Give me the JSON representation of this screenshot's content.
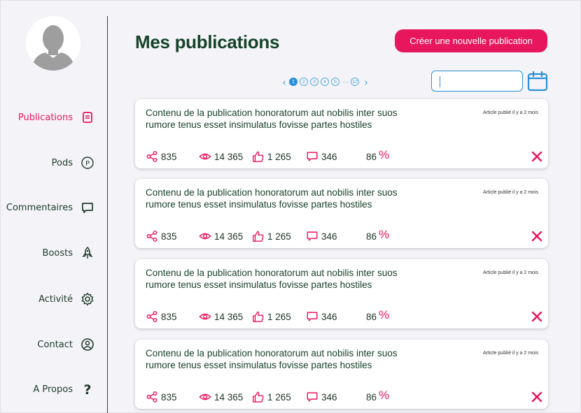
{
  "sidebar": {
    "items": [
      {
        "label": "Publications",
        "icon": "document-icon",
        "active": true
      },
      {
        "label": "Pods",
        "icon": "p-circle-icon",
        "active": false
      },
      {
        "label": "Commentaires",
        "icon": "comment-icon",
        "active": false
      },
      {
        "label": "Boosts",
        "icon": "rocket-icon",
        "active": false
      },
      {
        "label": "Activité",
        "icon": "gear-icon",
        "active": false
      },
      {
        "label": "Contact",
        "icon": "user-circle-icon",
        "active": false
      },
      {
        "label": "A Propos",
        "icon": "question-icon",
        "active": false
      }
    ]
  },
  "header": {
    "title": "Mes publications",
    "create_label": "Créer une nouvelle publication"
  },
  "pagination": {
    "pages": [
      "1",
      "2",
      "3",
      "4",
      "5"
    ],
    "ellipsis": "···",
    "last": "12",
    "current": "1"
  },
  "search": {
    "value": "",
    "placeholder": ""
  },
  "posts": [
    {
      "text": "Contenu de la publication honoratorum aut nobilis inter suos rumore tenus esset insimulatus fovisse partes hostiles",
      "date": "Article publié il y a 2 mois",
      "shares": "835",
      "views": "14 365",
      "likes": "1 265",
      "comments": "346",
      "percent": "86",
      "percent_symbol": "%"
    },
    {
      "text": "Contenu de la publication honoratorum aut nobilis inter suos rumore tenus esset insimulatus fovisse partes hostiles",
      "date": "Article publié il y a 2 mois",
      "shares": "835",
      "views": "14 365",
      "likes": "1 265",
      "comments": "346",
      "percent": "86",
      "percent_symbol": "%"
    },
    {
      "text": "Contenu de la publication honoratorum aut nobilis inter suos rumore tenus esset insimulatus fovisse partes hostiles",
      "date": "Article publié il y a 2 mois",
      "shares": "835",
      "views": "14 365",
      "likes": "1 265",
      "comments": "346",
      "percent": "86",
      "percent_symbol": "%"
    },
    {
      "text": "Contenu de la publication honoratorum aut nobilis inter suos rumore tenus esset insimulatus fovisse partes hostiles",
      "date": "Article publié il y a 2 mois",
      "shares": "835",
      "views": "14 365",
      "likes": "1 265",
      "comments": "346",
      "percent": "86",
      "percent_symbol": "%"
    }
  ],
  "colors": {
    "accent": "#e8175d",
    "primary_blue": "#2a8fd6",
    "dark_green": "#16432a",
    "background": "#f4f4f8"
  }
}
